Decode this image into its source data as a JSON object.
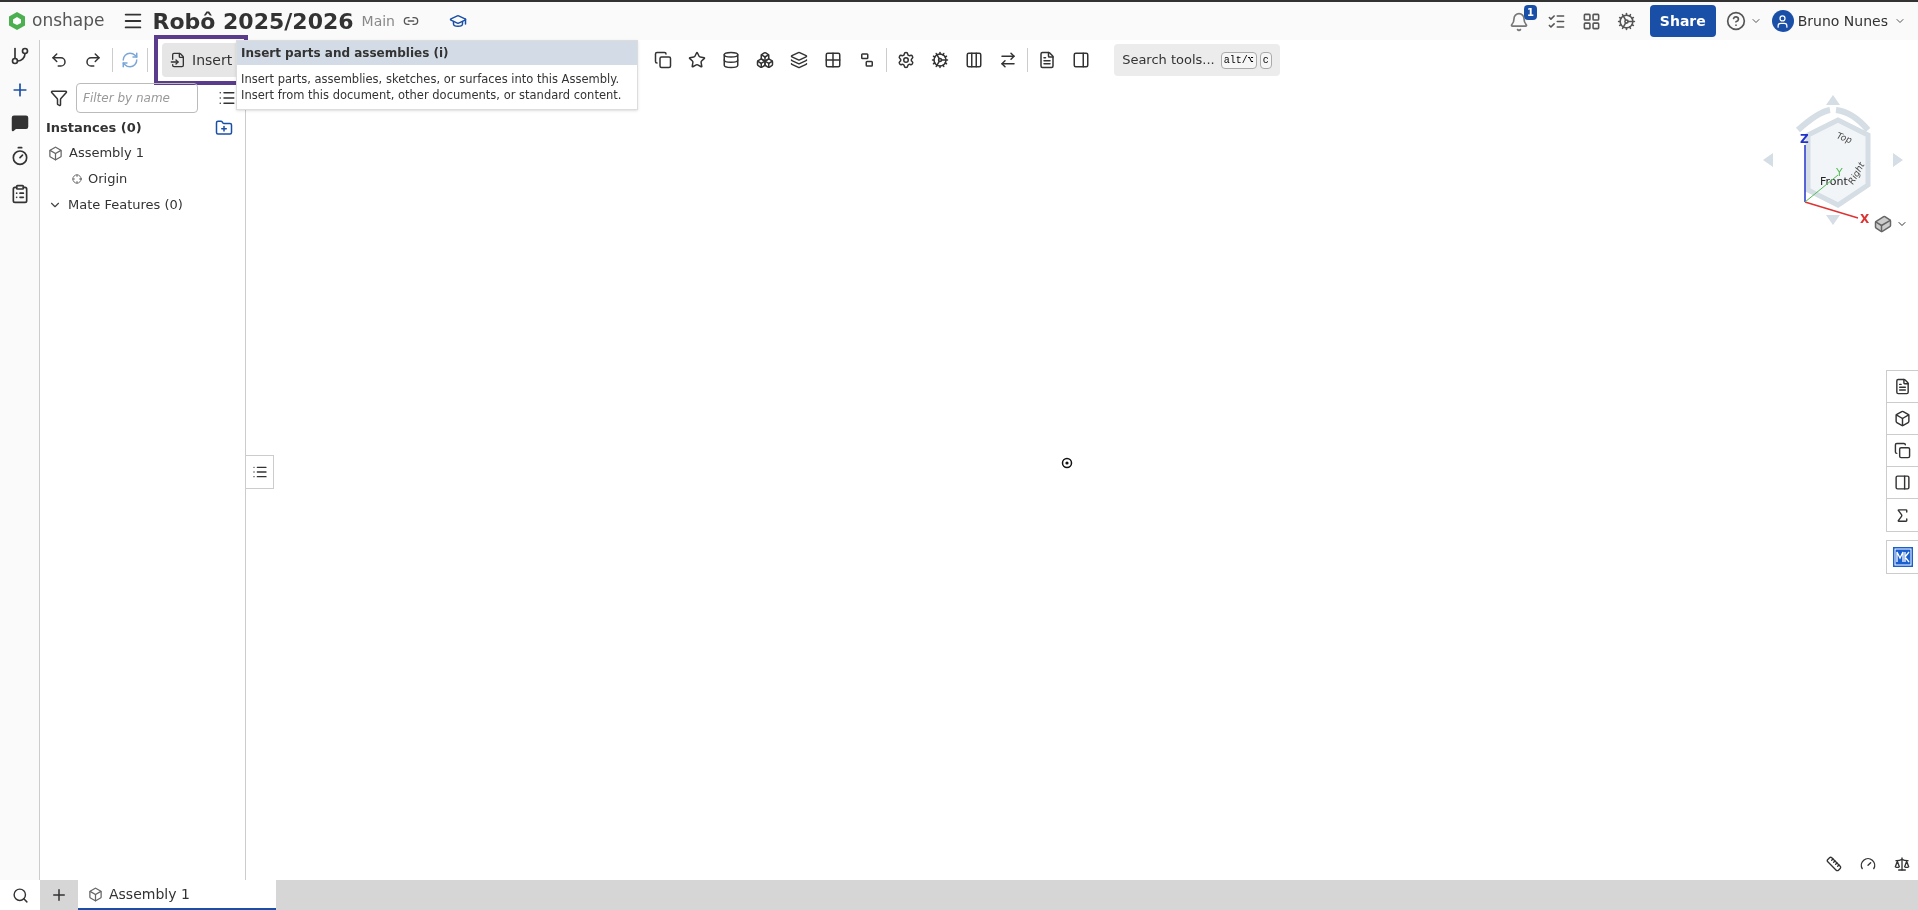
{
  "app": {
    "logo_text": "onshape",
    "document_title": "Robô 2025/2026",
    "branch": "Main",
    "notification_count": "1",
    "share_label": "Share",
    "user_name": "Bruno Nunes"
  },
  "toolbar": {
    "insert_label": "Insert",
    "search_label": "Search tools...",
    "shortcut_keys": [
      "alt/⌥",
      "c"
    ]
  },
  "tooltip": {
    "title": "Insert parts and assemblies (i)",
    "body": "Insert parts, assemblies, sketches, or surfaces into this Assembly. Insert from this document, other documents, or standard content."
  },
  "instances_panel": {
    "filter_placeholder": "Filter by name",
    "heading": "Instances (0)",
    "tree": [
      {
        "label": "Assembly 1",
        "kind": "assembly",
        "children": [
          {
            "label": "Origin",
            "kind": "origin"
          }
        ]
      },
      {
        "label": "Mate Features (0)",
        "kind": "group",
        "expanded": true
      }
    ]
  },
  "view_cube": {
    "faces": [
      "Top",
      "Front",
      "Right"
    ],
    "axes": [
      "X",
      "Y",
      "Z"
    ]
  },
  "tabs": [
    {
      "label": "Assembly 1",
      "selected": true
    }
  ]
}
